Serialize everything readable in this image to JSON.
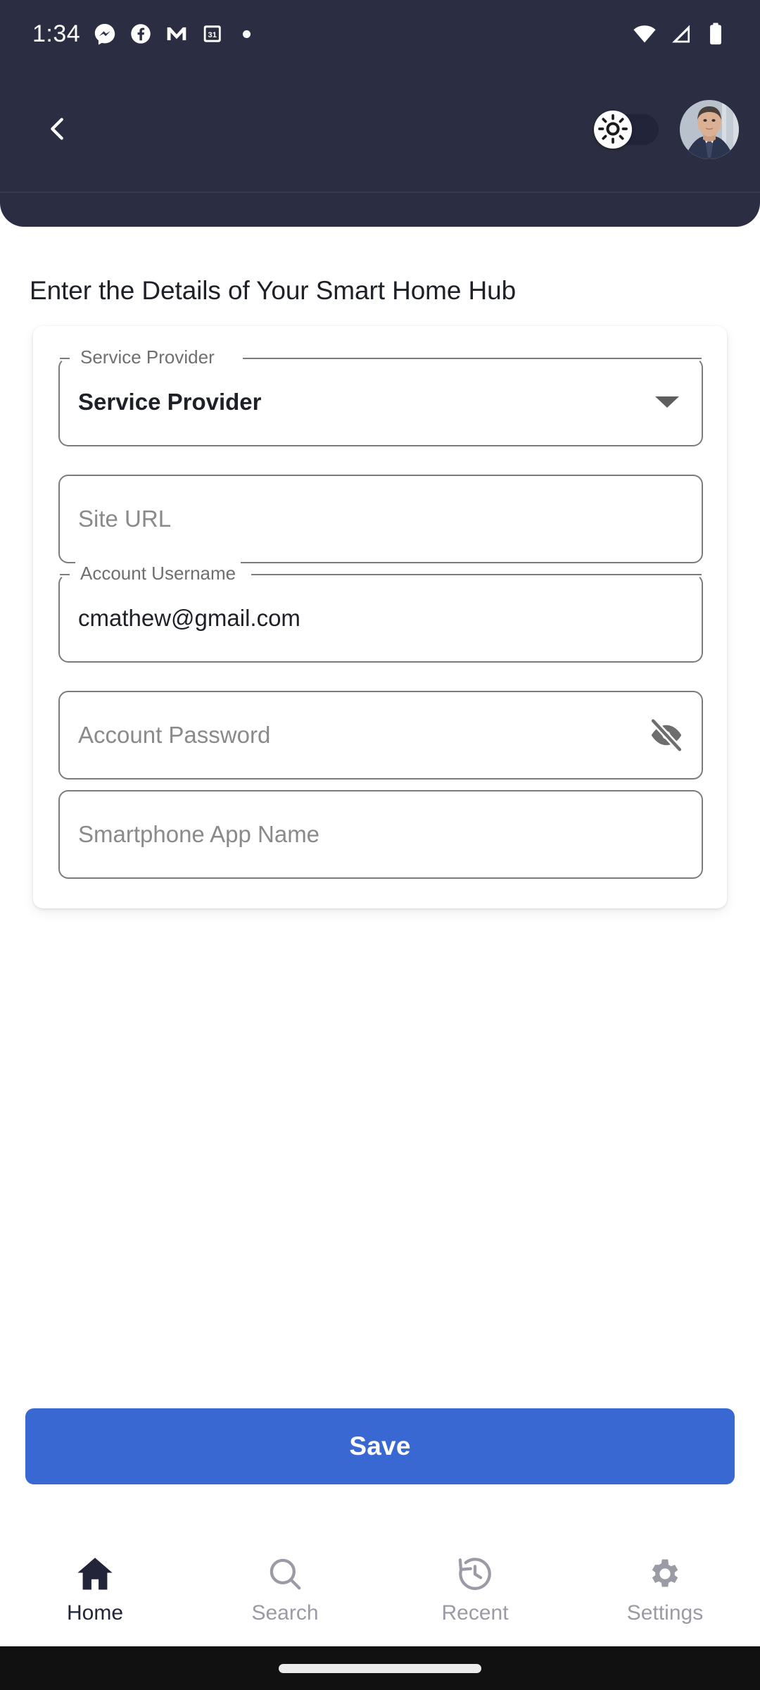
{
  "status_bar": {
    "time": "1:34",
    "notification_icons": [
      "messenger-icon",
      "facebook-icon",
      "gmail-icon",
      "calendar-icon",
      "notification-dot"
    ],
    "system_icons": [
      "wifi-icon",
      "cellular-signal-icon",
      "battery-icon"
    ],
    "background_color": "#2b2e42"
  },
  "app_bar": {
    "back_icon": "chevron-left-icon",
    "theme_toggle": {
      "name": "light-dark-mode-toggle",
      "state": "off",
      "knob_icon": "sun-icon"
    },
    "avatar": "user-profile-avatar",
    "background_color": "#2b2e42"
  },
  "page": {
    "title": "Enter the Details of Your Smart Home Hub"
  },
  "form": {
    "fields": [
      {
        "name": "service-provider",
        "type": "dropdown",
        "label": "Service Provider",
        "value": "Service Provider",
        "has_floating_label": true,
        "trailing_icon": "chevron-down-icon"
      },
      {
        "name": "site-url",
        "type": "text",
        "label": "",
        "placeholder": "Site URL",
        "value": "",
        "has_floating_label": false,
        "trailing_icon": ""
      },
      {
        "name": "account-username",
        "type": "text",
        "label": "Account Username",
        "placeholder": "",
        "value": "cmathew@gmail.com",
        "has_floating_label": true,
        "trailing_icon": ""
      },
      {
        "name": "account-password",
        "type": "password",
        "label": "",
        "placeholder": "Account Password",
        "value": "",
        "has_floating_label": false,
        "trailing_icon": "eye-off-icon"
      },
      {
        "name": "smartphone-app-name",
        "type": "text",
        "label": "",
        "placeholder": "Smartphone App Name",
        "value": "",
        "has_floating_label": false,
        "trailing_icon": ""
      }
    ]
  },
  "actions": {
    "save_label": "Save",
    "save_color": "#3a68d2"
  },
  "bottom_nav": {
    "items": [
      {
        "label": "Home",
        "icon": "home-icon",
        "active": true
      },
      {
        "label": "Search",
        "icon": "search-icon",
        "active": false
      },
      {
        "label": "Recent",
        "icon": "history-icon",
        "active": false
      },
      {
        "label": "Settings",
        "icon": "gear-icon",
        "active": false
      }
    ],
    "active_color": "#22253a",
    "inactive_color": "#9a9ba4"
  },
  "gesture_bar": {
    "handle": "home-gesture-pill"
  }
}
